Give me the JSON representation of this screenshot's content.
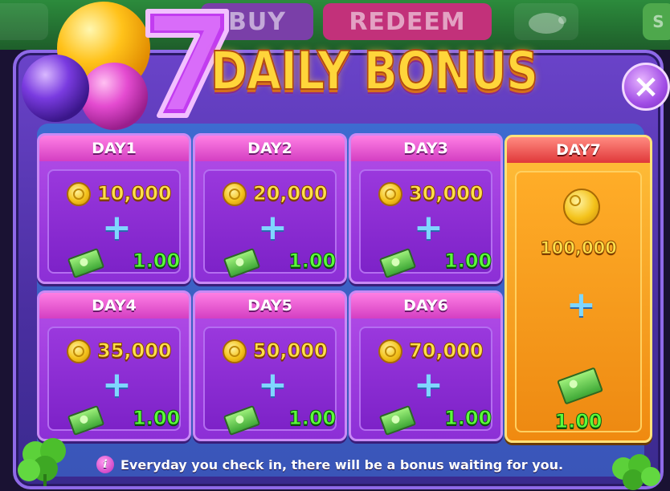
{
  "header": {
    "buy_label": "BUY",
    "redeem_label": "REDEEM",
    "right_label": "S"
  },
  "dialog": {
    "title": "DAILY BONUS",
    "title_numeral": "7",
    "close_glyph": "×",
    "footer_text": "Everyday you check in, there will be a bonus waiting for you.",
    "info_glyph": "i"
  },
  "days": [
    {
      "label": "DAY1",
      "coins": "10,000",
      "cash": "1.00"
    },
    {
      "label": "DAY2",
      "coins": "20,000",
      "cash": "1.00"
    },
    {
      "label": "DAY3",
      "coins": "30,000",
      "cash": "1.00"
    },
    {
      "label": "DAY4",
      "coins": "35,000",
      "cash": "1.00"
    },
    {
      "label": "DAY5",
      "coins": "50,000",
      "cash": "1.00"
    },
    {
      "label": "DAY6",
      "coins": "70,000",
      "cash": "1.00"
    },
    {
      "label": "DAY7",
      "coins": "100,000",
      "cash": "1.00"
    }
  ],
  "plus_glyph": "+",
  "colors": {
    "panel": "#6a43c9",
    "card": "#a93fe2",
    "card_header": "#e65bd3",
    "day7_card": "#f8a424",
    "day7_header": "#e0383a",
    "coin_text": "#ffe04a",
    "cash_text": "#5cff3a",
    "plus": "#7fd6ff"
  },
  "icons": {
    "coin": "coin-icon",
    "cash": "cash-icon",
    "plus": "plus-icon",
    "close": "close-icon",
    "info": "info-icon",
    "clover": "clover-icon",
    "balloon": "balloon-icon"
  }
}
